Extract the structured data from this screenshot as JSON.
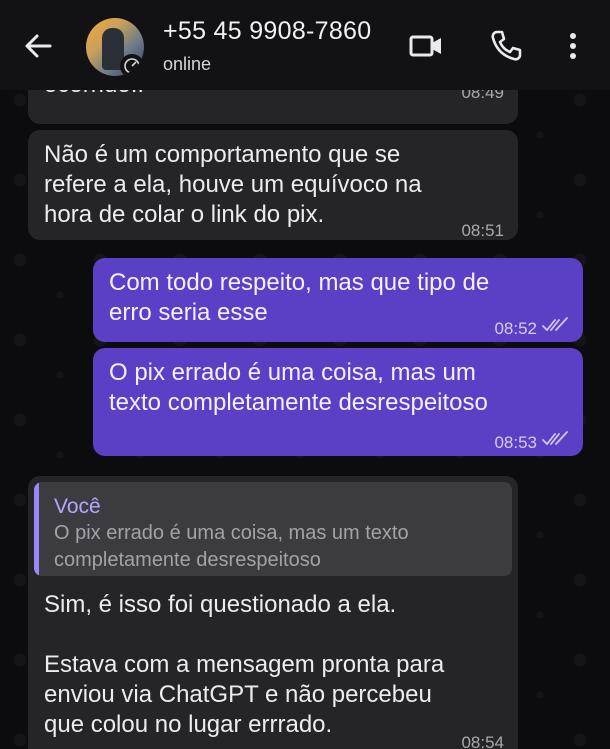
{
  "header": {
    "contact_name": "+55 45 9908-7860",
    "status": "online"
  },
  "colors": {
    "outgoing_bubble": "#5b3fc4",
    "incoming_bubble": "#252528",
    "quote_accent": "#9b86ff",
    "header_bg": "#121214"
  },
  "messages": [
    {
      "direction": "in",
      "text": "ocorrido..",
      "time": "08:49"
    },
    {
      "direction": "in",
      "text": "Não é um comportamento que se\nrefere a ela, houve um equívoco na\nhora de colar o link do pix.",
      "time": "08:51"
    },
    {
      "direction": "out",
      "text": "Com todo respeito, mas que tipo de\nerro seria esse",
      "time": "08:52",
      "status": "read"
    },
    {
      "direction": "out",
      "text": "O pix errado é uma coisa, mas um\ntexto completamente desrespeitoso",
      "time": "08:53",
      "status": "read"
    },
    {
      "direction": "in",
      "quote": {
        "author": "Você",
        "text": "O pix errado é uma coisa, mas um texto\ncompletamente desrespeitoso"
      },
      "text": "Sim, é isso foi questionado a ela.\n\nEstava com a mensagem pronta para\nenviou via ChatGPT e não percebeu\nque colou no lugar errrado.",
      "time": "08:54"
    }
  ]
}
